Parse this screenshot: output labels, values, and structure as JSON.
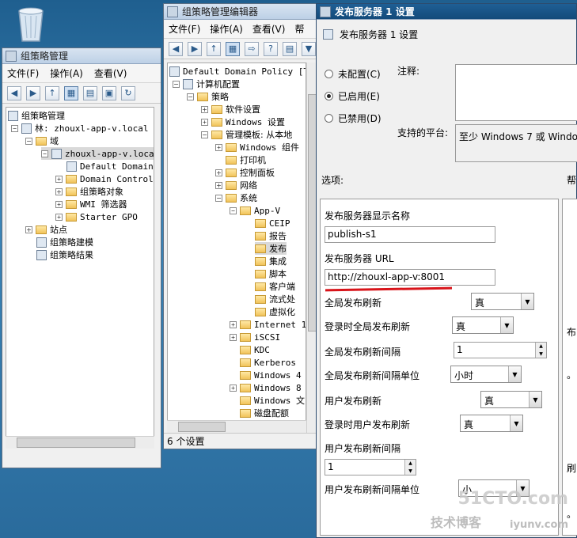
{
  "gpmc": {
    "title": "组策略管理",
    "menu": [
      "文件(F)",
      "操作(A)",
      "查看(V)"
    ],
    "tree": [
      {
        "label": "组策略管理",
        "level": 0
      },
      {
        "label": "林: zhouxl-app-v.local",
        "level": 1
      },
      {
        "label": "域",
        "level": 2
      },
      {
        "label": "zhouxl-app-v.loca",
        "level": 3,
        "selected": true
      },
      {
        "label": "Default Domain",
        "level": 4
      },
      {
        "label": "Domain Control",
        "level": 4
      },
      {
        "label": "组策略对象",
        "level": 4
      },
      {
        "label": "WMI 筛选器",
        "level": 4
      },
      {
        "label": "Starter GPO",
        "level": 4
      },
      {
        "label": "站点",
        "level": 2
      },
      {
        "label": "组策略建模",
        "level": 2
      },
      {
        "label": "组策略结果",
        "level": 2
      }
    ]
  },
  "gpme": {
    "title": "组策略管理编辑器",
    "menu": [
      "文件(F)",
      "操作(A)",
      "查看(V)",
      "帮"
    ],
    "tree": [
      {
        "label": "Default Domain Policy [TE",
        "level": 0
      },
      {
        "label": "计算机配置",
        "level": 1
      },
      {
        "label": "策略",
        "level": 2
      },
      {
        "label": "软件设置",
        "level": 3
      },
      {
        "label": "Windows 设置",
        "level": 3
      },
      {
        "label": "管理模板: 从本地",
        "level": 3
      },
      {
        "label": "Windows 组件",
        "level": 4
      },
      {
        "label": "打印机",
        "level": 4
      },
      {
        "label": "控制面板",
        "level": 4
      },
      {
        "label": "网络",
        "level": 4
      },
      {
        "label": "系统",
        "level": 4
      },
      {
        "label": "App-V",
        "level": 5
      },
      {
        "label": "CEIP",
        "level": 6
      },
      {
        "label": "报告",
        "level": 6
      },
      {
        "label": "发布",
        "level": 6,
        "selected": true
      },
      {
        "label": "集成",
        "level": 6
      },
      {
        "label": "脚本",
        "level": 6
      },
      {
        "label": "客户端",
        "level": 6
      },
      {
        "label": "流式处",
        "level": 6
      },
      {
        "label": "虚拟化",
        "level": 6
      },
      {
        "label": "Internet 1",
        "level": 5
      },
      {
        "label": "iSCSI",
        "level": 5
      },
      {
        "label": "KDC",
        "level": 5
      },
      {
        "label": "Kerberos",
        "level": 5
      },
      {
        "label": "Windows 4",
        "level": 5
      },
      {
        "label": "Windows 8",
        "level": 5
      },
      {
        "label": "Windows 文",
        "level": 5
      },
      {
        "label": "磁盘配额",
        "level": 5
      }
    ],
    "status": "6 个设置"
  },
  "dialog": {
    "title": "发布服务器 1 设置",
    "heading": "发布服务器 1 设置",
    "radios": {
      "not_configured": "未配置(C)",
      "enabled": "已启用(E)",
      "disabled": "已禁用(D)"
    },
    "comment_label": "注释:",
    "platform_label": "支持的平台:",
    "platform_value": "至少 Windows 7 或 Windo",
    "options_label": "选项:",
    "help_label": "帮",
    "fields": {
      "display_name_label": "发布服务器显示名称",
      "display_name_value": "publish-s1",
      "url_label": "发布服务器 URL",
      "url_value": "http://zhouxl-app-v:8001",
      "global_refresh_label": "全局发布刷新",
      "global_refresh_value": "真",
      "logon_global_refresh_label": "登录时全局发布刷新",
      "logon_global_refresh_value": "真",
      "global_interval_label": "全局发布刷新间隔",
      "global_interval_value": "1",
      "global_interval_unit_label": "全局发布刷新间隔单位",
      "global_interval_unit_value": "小时",
      "user_refresh_label": "用户发布刷新",
      "user_refresh_value": "真",
      "logon_user_refresh_label": "登录时用户发布刷新",
      "logon_user_refresh_value": "真",
      "user_interval_label": "用户发布刷新间隔",
      "user_interval_value": "1",
      "user_interval_unit_label": "用户发布刷新间隔单位",
      "user_interval_unit_value": "小"
    },
    "right_fragments": [
      "布",
      "。",
      "刷",
      "。"
    ]
  },
  "watermark": {
    "line1": "51CTO.com",
    "line2": "技术博客",
    "line3": "iyunv.com"
  }
}
